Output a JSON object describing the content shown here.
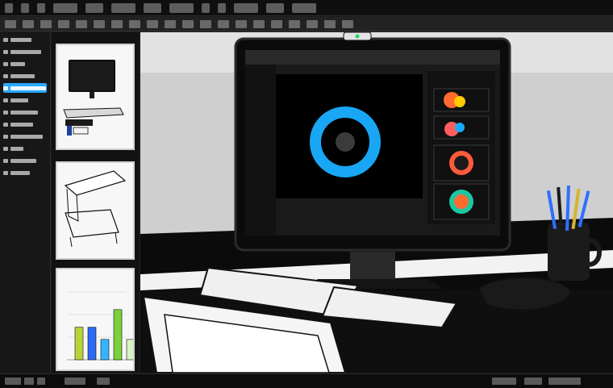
{
  "topbar": {
    "item_count": 14
  },
  "sidebar": {
    "rows": [
      {
        "selected": false
      },
      {
        "selected": false
      },
      {
        "selected": false
      },
      {
        "selected": false
      },
      {
        "selected": true
      },
      {
        "selected": false
      },
      {
        "selected": false
      },
      {
        "selected": false
      },
      {
        "selected": false
      },
      {
        "selected": false
      },
      {
        "selected": false
      },
      {
        "selected": false
      }
    ]
  },
  "thumbnails": {
    "items": [
      {
        "name": "monitor-sketch"
      },
      {
        "name": "desk-sketch"
      },
      {
        "name": "bar-chart"
      }
    ],
    "bar_chart_values": [
      0.48,
      0.48,
      0.3,
      0.74,
      0.3
    ]
  },
  "illustration": {
    "monitor_label": "",
    "colors": {
      "accent_blue": "#29a8ff",
      "ring_blue": "#19a7f5",
      "pencil_cup": "#1b1b1b"
    }
  }
}
